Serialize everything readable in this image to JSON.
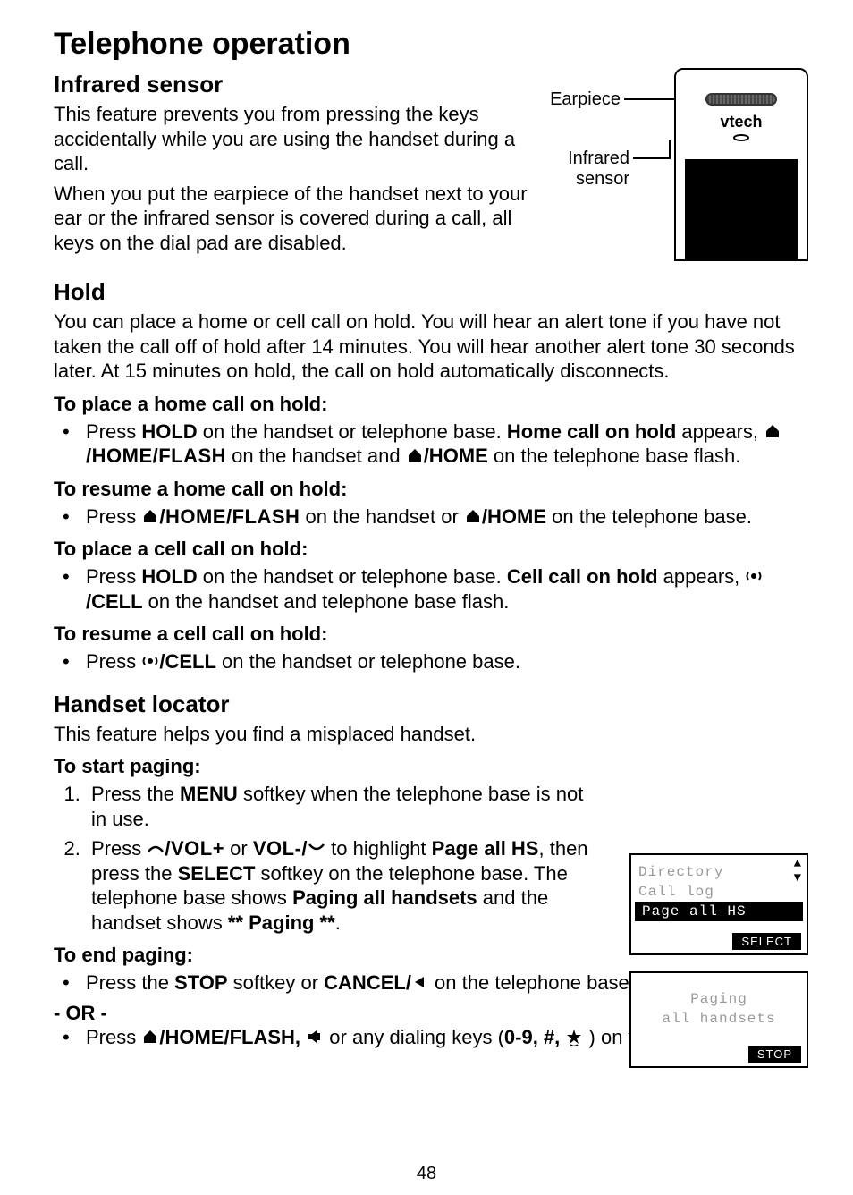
{
  "title": "Telephone operation",
  "sections": {
    "infrared": {
      "heading": "Infrared sensor",
      "p1": "This feature prevents you from pressing the keys accidentally while you are using the handset during a call.",
      "p2": "When you put the earpiece of the handset next to your ear or the infrared sensor is covered during a call, all keys on the dial pad are disabled."
    },
    "hold": {
      "heading": "Hold",
      "intro": "You can place a home or cell call on hold. You will hear an alert tone if you have not taken the call off of hold after 14 minutes. You will hear another alert tone 30 seconds later. At 15 minutes on hold, the call on hold automatically disconnects.",
      "place_home_h": "To place a home call on hold:",
      "place_home_li_a": "Press ",
      "place_home_li_b": " on the handset or telephone base. ",
      "place_home_li_c": " appears, ",
      "place_home_li_d": " on the handset and ",
      "place_home_li_e": " on the telephone base flash.",
      "hold_key": "HOLD",
      "home_call_hold": "Home call on hold",
      "home_flash": "/HOME/FLASH",
      "home_key": "/HOME",
      "resume_home_h": "To resume a home call on hold:",
      "resume_home_li_a": "Press ",
      "resume_home_li_b": " on the handset or ",
      "resume_home_li_c": " on the telephone base.",
      "place_cell_h": "To place a cell call on hold:",
      "place_cell_li_a": "Press ",
      "place_cell_li_b": " on the handset or telephone base. ",
      "place_cell_li_c": " appears, ",
      "place_cell_li_d": " on the handset and telephone base flash.",
      "cell_call_hold": "Cell call on hold",
      "cell_key": "/CELL",
      "resume_cell_h": "To resume a cell call on hold:",
      "resume_cell_li_a": "Press ",
      "resume_cell_li_b": " on the handset or telephone base."
    },
    "locator": {
      "heading": "Handset locator",
      "intro": "This feature helps you find a misplaced handset.",
      "start_h": "To start paging:",
      "ol1_a": "Press the ",
      "ol1_b": " softkey when the telephone base is not in use.",
      "menu": "MENU",
      "ol2_a": "Press ",
      "ol2_b": " or ",
      "ol2_c": " to highlight ",
      "ol2_d": ", then press the ",
      "ol2_e": " softkey on the telephone base. The telephone base shows ",
      "ol2_f": " and the handset shows ",
      "ol2_g": ".",
      "volup": "/VOL+",
      "voldown": "VOL-/",
      "page_all": "Page all HS",
      "select": "SELECT",
      "paging_all": "Paging all handsets",
      "paging_stars": "** Paging **",
      "end_h": "To end paging:",
      "end_li_a": "Press the ",
      "end_li_b": " softkey or ",
      "end_li_c": " on the telephone base.",
      "stop": "STOP",
      "cancel": "CANCEL/",
      "or": "- OR -",
      "end2_a": "Press ",
      "end2_b": " or any dialing keys (",
      "end2_c": ") on the handset.",
      "home_flash_bold": "/HOME/FLASH,",
      "keys": "0-9, #, "
    }
  },
  "diagram": {
    "earpiece": "Earpiece",
    "infrared": "Infrared",
    "sensor": "sensor",
    "logo": "vtech"
  },
  "lcd1": {
    "row1": "Directory",
    "row2": "Call log",
    "row3": "Page all HS",
    "btn": "SELECT"
  },
  "lcd2": {
    "line1": "Paging",
    "line2": "all handsets",
    "btn": "STOP"
  },
  "page": "48"
}
